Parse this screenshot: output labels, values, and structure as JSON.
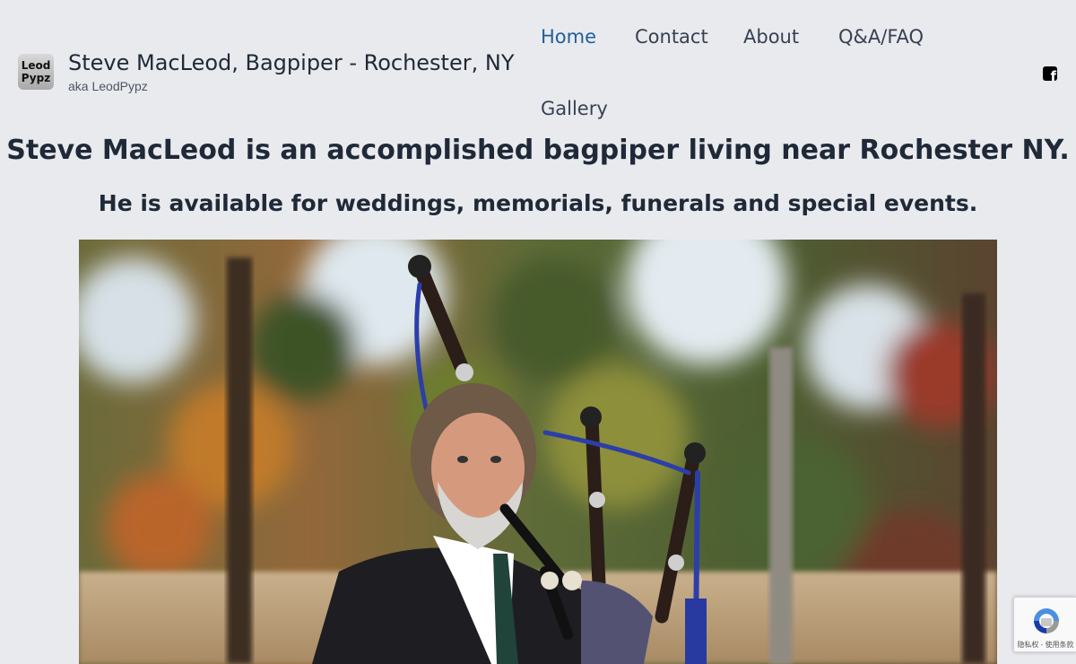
{
  "header": {
    "logo_line1": "Leod",
    "logo_line2": "Pypz",
    "title": "Steve MacLeod, Bagpiper - Rochester, NY",
    "tagline": "aka LeodPypz"
  },
  "nav": {
    "items": [
      {
        "label": "Home",
        "active": true
      },
      {
        "label": "Contact",
        "active": false
      },
      {
        "label": "About",
        "active": false
      },
      {
        "label": "Q&A/FAQ",
        "active": false
      },
      {
        "label": "Gallery",
        "active": false
      }
    ]
  },
  "social": {
    "facebook_icon": "facebook-icon"
  },
  "main": {
    "headline": "Steve MacLeod is an accomplished bagpiper living near Rochester NY.",
    "subheadline": "He is available for weddings, memorials, funerals and special events.",
    "photo_icon": "photo-of-bagpiper"
  },
  "recaptcha": {
    "footer": "隐私权 - 使用条款"
  },
  "colors": {
    "background": "#e9eaee",
    "nav_active": "#1f5f9e",
    "text": "#1f2937"
  }
}
